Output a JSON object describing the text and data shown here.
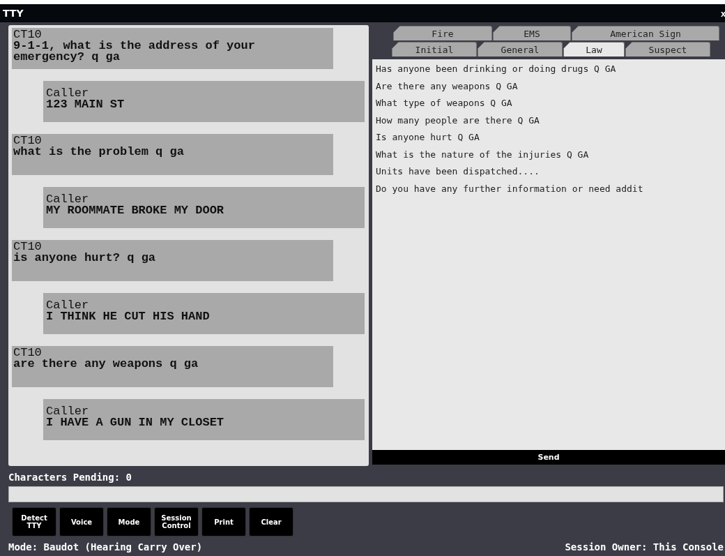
{
  "window": {
    "title": "TTY",
    "close": "x"
  },
  "conversation": [
    {
      "kind": "operator",
      "sender": "CT10",
      "text": "9-1-1, what is the address of your emergency? q ga"
    },
    {
      "kind": "caller",
      "sender": "Caller",
      "text": "123 MAIN ST"
    },
    {
      "kind": "operator",
      "sender": "CT10",
      "text": "what is the problem q ga"
    },
    {
      "kind": "caller",
      "sender": "Caller",
      "text": "MY ROOMMATE BROKE MY DOOR"
    },
    {
      "kind": "operator",
      "sender": "CT10",
      "text": "is anyone hurt? q ga"
    },
    {
      "kind": "caller",
      "sender": "Caller",
      "text": "I THINK HE CUT HIS HAND"
    },
    {
      "kind": "operator",
      "sender": "CT10",
      "text": "are there any weapons q ga"
    },
    {
      "kind": "caller",
      "sender": "Caller",
      "text": "I HAVE A GUN IN MY CLOSET"
    }
  ],
  "tab_rows": [
    [
      {
        "label": "Fire",
        "selected": false
      },
      {
        "label": "EMS",
        "selected": false
      },
      {
        "label": "American Sign",
        "selected": false
      }
    ],
    [
      {
        "label": "Initial",
        "selected": false
      },
      {
        "label": "General",
        "selected": false
      },
      {
        "label": "Law",
        "selected": true
      },
      {
        "label": "Suspect",
        "selected": false
      }
    ]
  ],
  "phrases": [
    "Has anyone been drinking or doing drugs Q GA",
    "Are there any weapons Q GA",
    "What type of weapons Q GA",
    "How many people are there Q GA",
    "Is anyone hurt Q GA",
    "What is the nature of the injuries Q GA",
    "Units have been dispatched....",
    "Do you have any further information or need addit"
  ],
  "send_button": "Send",
  "characters_pending": "Characters Pending: 0",
  "buttons": [
    [
      "Detect",
      "TTY"
    ],
    [
      "Voice"
    ],
    [
      "Mode"
    ],
    [
      "Session",
      "Control"
    ],
    [
      "Print"
    ],
    [
      "Clear"
    ]
  ],
  "status_bar": {
    "mode": "Mode: Baudot (Hearing Carry Over)",
    "owner": "Session Owner: This Console"
  }
}
